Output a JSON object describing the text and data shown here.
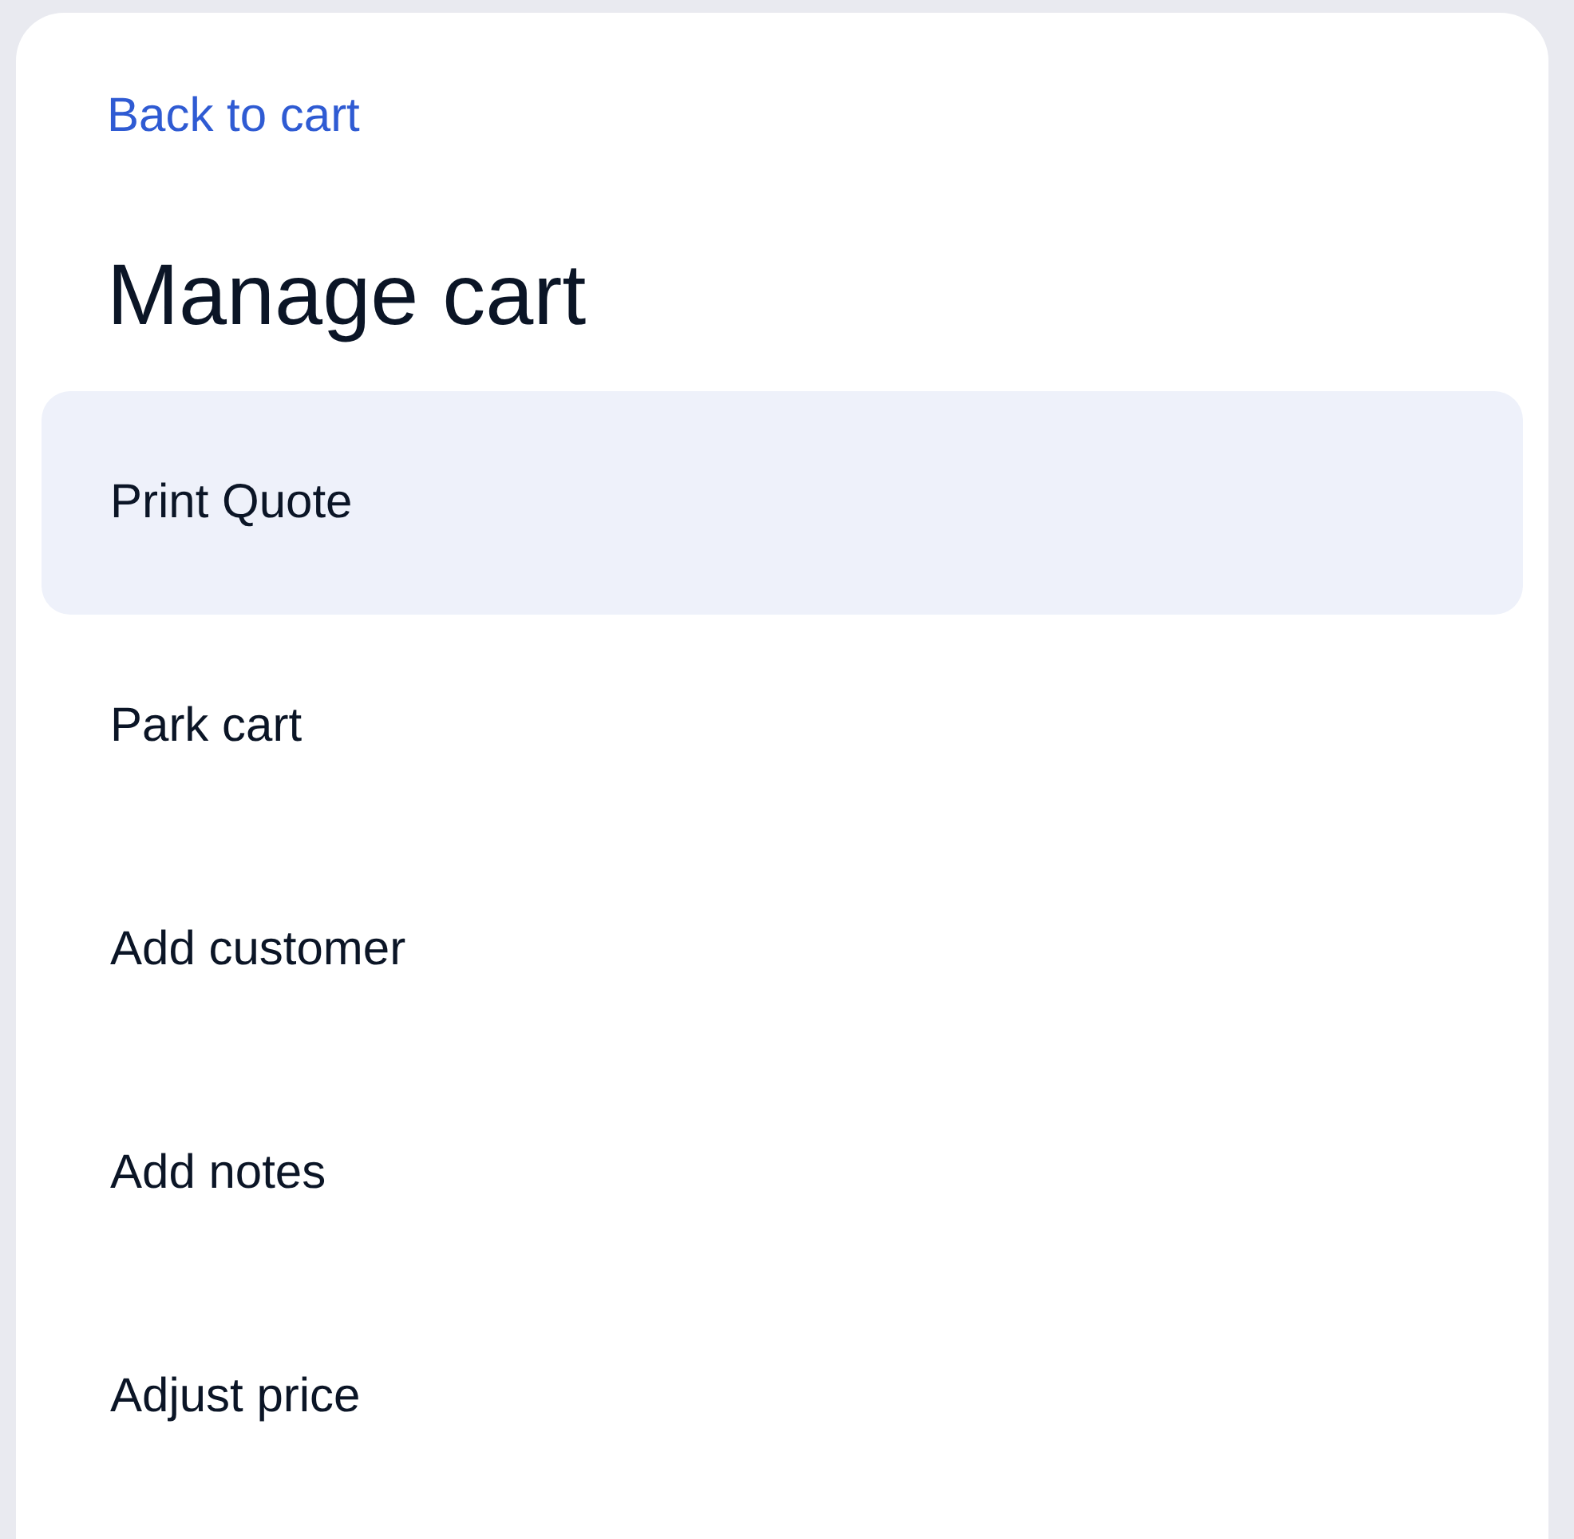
{
  "back_link": "Back to cart",
  "title": "Manage cart",
  "menu": [
    {
      "label": "Print Quote",
      "selected": true
    },
    {
      "label": "Park cart",
      "selected": false
    },
    {
      "label": "Add customer",
      "selected": false
    },
    {
      "label": "Add notes",
      "selected": false
    },
    {
      "label": "Adjust price",
      "selected": false
    }
  ]
}
